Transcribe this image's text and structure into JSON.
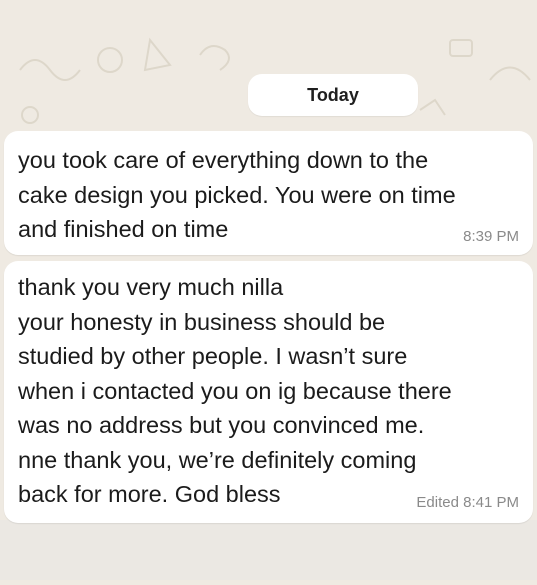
{
  "date_divider": {
    "label": "Today"
  },
  "messages": [
    {
      "text": "you took care of everything down to the\ncake design you picked. You were on time\nand finished on time",
      "time": "8:39 PM",
      "edited": ""
    },
    {
      "text": "thank you very much nilla\nyour honesty in business should be\nstudied by other people. I wasn’t sure\nwhen i contacted you on ig because there\nwas no address but you convinced me.\nnne thank you, we’re definitely coming\nback for more. God bless",
      "time": "8:41 PM",
      "edited": "Edited"
    }
  ],
  "colors": {
    "chat_background": "#efeae2",
    "bubble": "#ffffff",
    "text": "#1b1b1b",
    "meta": "#8a8a8a"
  }
}
